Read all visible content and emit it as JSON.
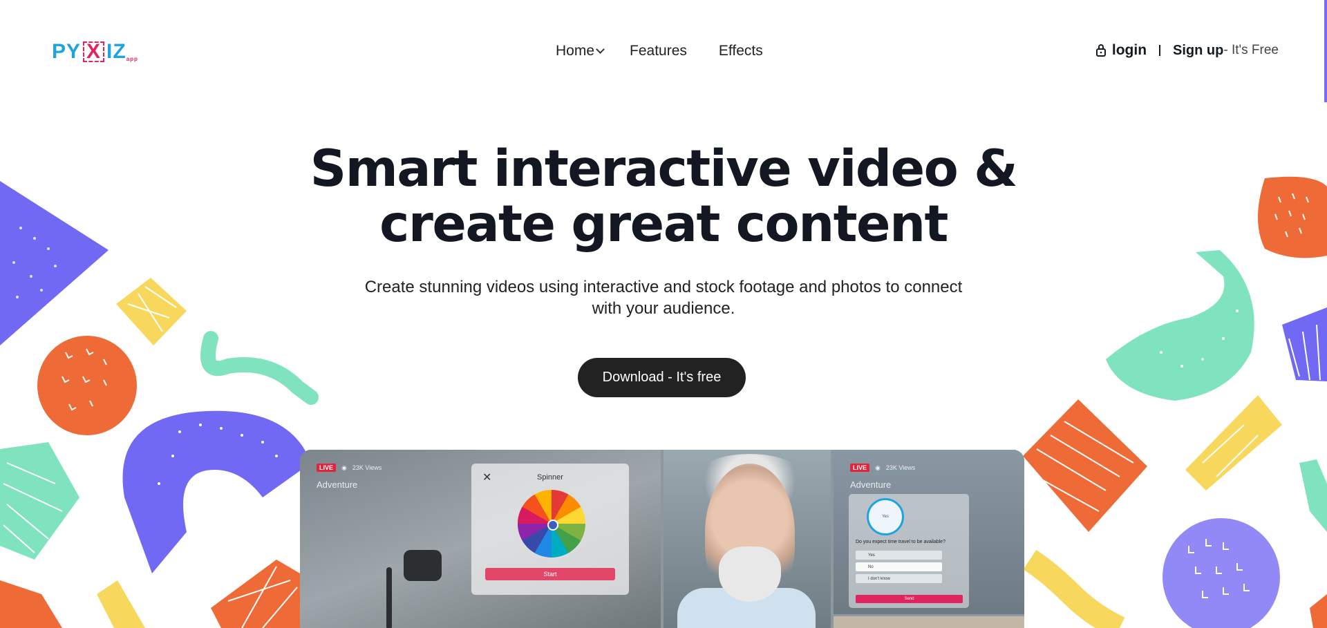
{
  "header": {
    "logo": {
      "part1": "PY",
      "part2": "X",
      "part3": "IZ",
      "suffix": "app"
    },
    "nav": [
      {
        "label": "Home",
        "has_dropdown": true
      },
      {
        "label": "Features"
      },
      {
        "label": "Effects"
      }
    ],
    "login_label": "login",
    "signup_label": "Sign up",
    "signup_suffix": "- It's Free"
  },
  "hero": {
    "title_line1": "Smart interactive video &",
    "title_line2": "create great content",
    "subtitle_line1": "Create stunning videos using interactive and stock footage and photos to connect",
    "subtitle_line2": "with your audience.",
    "cta_label": "Download - It's free"
  },
  "preview": {
    "live_badge": "LIVE",
    "views": "23K Views",
    "channel": "Adventure",
    "spinner_title": "Spinner",
    "spinner_button": "Start",
    "quiz_circle": "Yes",
    "quiz_question": "Do you expect time travel to be available?",
    "quiz_options": [
      "Yes",
      "No",
      "I don't know"
    ],
    "quiz_send": "Send"
  },
  "colors": {
    "brand_blue": "#1fa3e0",
    "brand_pink": "#e0245e",
    "cta_bg": "#222222",
    "purple": "#7169f4",
    "mint": "#7fe3be",
    "orange": "#ee6a36",
    "yellow": "#f7d85c"
  }
}
